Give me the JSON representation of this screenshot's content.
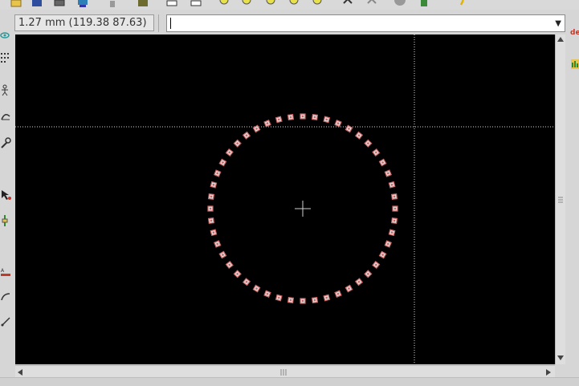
{
  "status": {
    "zoom_text": "1.27 mm (119.38 87.63)"
  },
  "net_selector": {
    "value": ""
  },
  "right_panel": {
    "label": "de"
  },
  "toolbar": {
    "icons": [
      "open-icon",
      "save-icon",
      "print-icon",
      "plot-icon",
      "undo-icon",
      "footprint-icon",
      "layer-icon",
      "netlist-icon",
      "zoom-in-icon",
      "zoom-out-icon",
      "zoom-redraw-icon",
      "zoom-fit-icon",
      "zoom-selection-icon",
      "rotate-icon",
      "rotate-ccw-icon",
      "stop-icon",
      "drc-icon",
      "help-icon"
    ]
  },
  "left_toolbar": {
    "icons": [
      "visibility-icon",
      "grid-icon",
      "ratsnest-icon",
      "polar-coord-icon",
      "wrench-icon",
      "select-icon",
      "via-icon",
      "text-icon",
      "arc-icon",
      "line-icon"
    ]
  },
  "canvas": {
    "background": "#000000",
    "pad_color": "#cc6666",
    "pad_count": 48
  }
}
